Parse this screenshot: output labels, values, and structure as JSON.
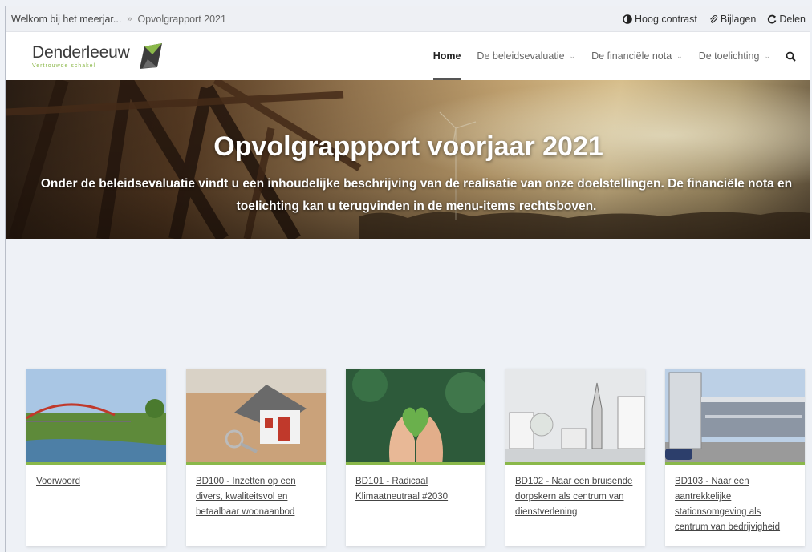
{
  "breadcrumb": {
    "home": "Welkom bij het meerjar...",
    "separator": "»",
    "current": "Opvolgrapport 2021"
  },
  "utilities": [
    {
      "label": "Hoog contrast",
      "icon": "contrast-icon"
    },
    {
      "label": "Bijlagen",
      "icon": "paperclip-icon"
    },
    {
      "label": "Delen",
      "icon": "share-icon"
    }
  ],
  "logo": {
    "name": "Denderleeuw",
    "tagline": "Vertrouwde schakel"
  },
  "nav": {
    "items": [
      {
        "label": "Home",
        "active": true,
        "dropdown": false
      },
      {
        "label": "De beleidsevaluatie",
        "active": false,
        "dropdown": true
      },
      {
        "label": "De financiële nota",
        "active": false,
        "dropdown": true
      },
      {
        "label": "De toelichting",
        "active": false,
        "dropdown": true
      }
    ],
    "search_icon": "search-icon"
  },
  "hero": {
    "title": "Opvolgrappport voorjaar 2021",
    "subtitle": "Onder de beleidsevaluatie vindt u een inhoudelijke beschrijving van de realisatie van onze doelstellingen. De financiële nota en toelichting kan u terugvinden in de menu-items rechtsboven."
  },
  "cards": [
    {
      "title": "Voorwoord",
      "image": "bridge-over-river"
    },
    {
      "title": "BD100 - Inzetten op een divers, kwaliteitsvol en betaalbaar woonaanbod",
      "image": "house-with-keys"
    },
    {
      "title": "BD101 - Radicaal Klimaatneutraal #2030",
      "image": "hands-holding-green-heart"
    },
    {
      "title": "BD102 - Naar een bruisende dorpskern als centrum van dienstverlening",
      "image": "village-center-sketch"
    },
    {
      "title": "BD103 - Naar een aantrekkelijke stationsomgeving als centrum van bedrijvigheid",
      "image": "station-building"
    }
  ],
  "colors": {
    "accent_green": "#8ab84a",
    "topbar_bg": "#eef0f4",
    "page_bg": "#eef1f6"
  }
}
